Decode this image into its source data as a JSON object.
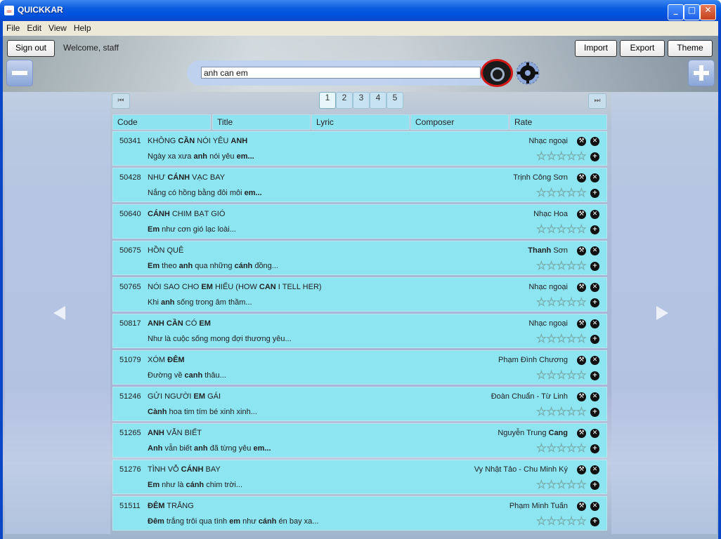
{
  "window": {
    "title": "QUICKKAR",
    "min": "_",
    "max": "□",
    "close": "✕"
  },
  "menu": [
    "File",
    "Edit",
    "View",
    "Help"
  ],
  "header": {
    "signout": "Sign out",
    "welcome": "Welcome, staff",
    "import": "Import",
    "export": "Export",
    "theme": "Theme"
  },
  "search": {
    "value": "anh can em"
  },
  "pagination": {
    "pages": [
      "1",
      "2",
      "3",
      "4",
      "5"
    ],
    "current": "1",
    "first": "⏮",
    "last": "⏭"
  },
  "columns": [
    "Code",
    "Title",
    "Lyric",
    "Composer",
    "Rate"
  ],
  "icons": {
    "edit": "wrench-icon",
    "delete": "close-icon",
    "add": "plus-icon",
    "search": "search-icon",
    "settings": "gear-icon"
  },
  "rows": [
    {
      "code": "50341",
      "title": [
        [
          "KHÔNG ",
          0
        ],
        [
          "CẦN",
          1
        ],
        [
          " NÓI YÊU ",
          0
        ],
        [
          "ANH",
          1
        ]
      ],
      "lyric": [
        [
          "Ngày xa xưa ",
          0
        ],
        [
          "anh",
          1
        ],
        [
          " nói yêu ",
          0
        ],
        [
          "em...",
          1
        ]
      ],
      "composer": [
        [
          "Nhạc ngoại",
          0
        ]
      ],
      "rating": 0
    },
    {
      "code": "50428",
      "title": [
        [
          "NHƯ ",
          0
        ],
        [
          "CÁNH",
          1
        ],
        [
          " VẠC BAY",
          0
        ]
      ],
      "lyric": [
        [
          "Nắng có hồng bằng đôi môi ",
          0
        ],
        [
          "em...",
          1
        ]
      ],
      "composer": [
        [
          "Trịnh Công Sơn",
          0
        ]
      ],
      "rating": 0
    },
    {
      "code": "50640",
      "title": [
        [
          "CÁNH",
          1
        ],
        [
          " CHIM BẠT GIÓ",
          0
        ]
      ],
      "lyric": [
        [
          "Em",
          1
        ],
        [
          " như cơn gió lạc loài...",
          0
        ]
      ],
      "composer": [
        [
          "Nhạc Hoa",
          0
        ]
      ],
      "rating": 0
    },
    {
      "code": "50675",
      "title": [
        [
          "HỒN QUÊ",
          0
        ]
      ],
      "lyric": [
        [
          "Em",
          1
        ],
        [
          " theo ",
          0
        ],
        [
          "anh",
          1
        ],
        [
          " qua những ",
          0
        ],
        [
          "cánh",
          1
        ],
        [
          " đồng...",
          0
        ]
      ],
      "composer": [
        [
          "Thanh",
          1
        ],
        [
          " Sơn",
          0
        ]
      ],
      "rating": 0
    },
    {
      "code": "50765",
      "title": [
        [
          "NÓI SAO CHO ",
          0
        ],
        [
          "EM",
          1
        ],
        [
          " HIỂU (HOW ",
          0
        ],
        [
          "CAN",
          1
        ],
        [
          " I TELL HER)",
          0
        ]
      ],
      "lyric": [
        [
          "Khi ",
          0
        ],
        [
          "anh",
          1
        ],
        [
          " sống trong âm thầm...",
          0
        ]
      ],
      "composer": [
        [
          "Nhạc ngoại",
          0
        ]
      ],
      "rating": 0
    },
    {
      "code": "50817",
      "title": [
        [
          "ANH CẦN",
          1
        ],
        [
          " CÓ ",
          0
        ],
        [
          "EM",
          1
        ]
      ],
      "lyric": [
        [
          "Như là cuộc sống mong đợi thương yêu...",
          0
        ]
      ],
      "composer": [
        [
          "Nhạc ngoại",
          0
        ]
      ],
      "rating": 0
    },
    {
      "code": "51079",
      "title": [
        [
          "XÓM ",
          0
        ],
        [
          "ĐÊM",
          1
        ]
      ],
      "lyric": [
        [
          "Đường về ",
          0
        ],
        [
          "canh",
          1
        ],
        [
          " thâu...",
          0
        ]
      ],
      "composer": [
        [
          "Phạm Đình Chương",
          0
        ]
      ],
      "rating": 0
    },
    {
      "code": "51246",
      "title": [
        [
          "GỬI NGƯỜI ",
          0
        ],
        [
          "EM",
          1
        ],
        [
          " GÁI",
          0
        ]
      ],
      "lyric": [
        [
          "Cành",
          1
        ],
        [
          " hoa tim tím bé xinh xinh...",
          0
        ]
      ],
      "composer": [
        [
          "Đoàn Chuẩn - Từ Linh",
          0
        ]
      ],
      "rating": 0
    },
    {
      "code": "51265",
      "title": [
        [
          "ANH",
          1
        ],
        [
          " VẪN BIẾT",
          0
        ]
      ],
      "lyric": [
        [
          "Anh",
          1
        ],
        [
          " vẫn biết ",
          0
        ],
        [
          "anh",
          1
        ],
        [
          " đã từng yêu ",
          0
        ],
        [
          "em...",
          1
        ]
      ],
      "composer": [
        [
          "Nguyễn Trung ",
          0
        ],
        [
          "Cang",
          1
        ]
      ],
      "rating": 0
    },
    {
      "code": "51276",
      "title": [
        [
          "TÌNH VỖ ",
          0
        ],
        [
          "CÁNH",
          1
        ],
        [
          " BAY",
          0
        ]
      ],
      "lyric": [
        [
          "Em",
          1
        ],
        [
          " như là ",
          0
        ],
        [
          "cánh",
          1
        ],
        [
          " chim trời...",
          0
        ]
      ],
      "composer": [
        [
          "Vy Nhật Tảo - Chu Minh Ký",
          0
        ]
      ],
      "rating": 0
    },
    {
      "code": "51511",
      "title": [
        [
          "ĐÊM",
          1
        ],
        [
          " TRẮNG",
          0
        ]
      ],
      "lyric": [
        [
          "Đêm",
          1
        ],
        [
          " trắng trôi qua tình ",
          0
        ],
        [
          "em",
          1
        ],
        [
          " như ",
          0
        ],
        [
          "cánh",
          1
        ],
        [
          " én bay xa...",
          0
        ]
      ],
      "composer": [
        [
          "Phạm Minh Tuấn",
          0
        ]
      ],
      "rating": 0
    }
  ]
}
